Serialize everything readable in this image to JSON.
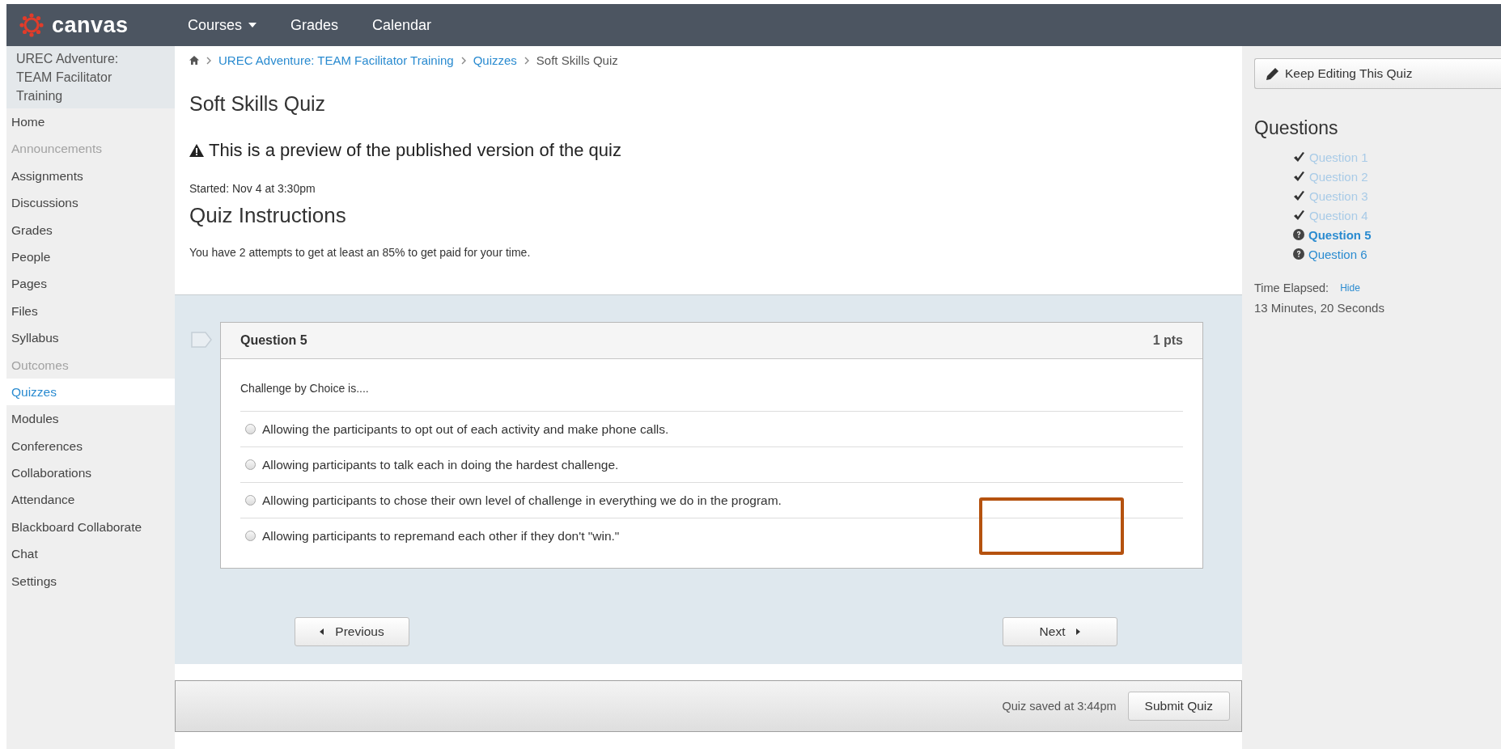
{
  "header": {
    "logo": "canvas",
    "nav": [
      {
        "label": "Courses",
        "dropdown": true
      },
      {
        "label": "Grades",
        "dropdown": false
      },
      {
        "label": "Calendar",
        "dropdown": false
      }
    ]
  },
  "sidebar": {
    "course_title": "UREC Adventure: TEAM Facilitator Training",
    "items": [
      {
        "label": "Home",
        "selected": false,
        "disabled": false
      },
      {
        "label": "Announcements",
        "selected": false,
        "disabled": true
      },
      {
        "label": "Assignments",
        "selected": false,
        "disabled": false
      },
      {
        "label": "Discussions",
        "selected": false,
        "disabled": false
      },
      {
        "label": "Grades",
        "selected": false,
        "disabled": false
      },
      {
        "label": "People",
        "selected": false,
        "disabled": false
      },
      {
        "label": "Pages",
        "selected": false,
        "disabled": false
      },
      {
        "label": "Files",
        "selected": false,
        "disabled": false
      },
      {
        "label": "Syllabus",
        "selected": false,
        "disabled": false
      },
      {
        "label": "Outcomes",
        "selected": false,
        "disabled": true
      },
      {
        "label": "Quizzes",
        "selected": true,
        "disabled": false
      },
      {
        "label": "Modules",
        "selected": false,
        "disabled": false
      },
      {
        "label": "Conferences",
        "selected": false,
        "disabled": false
      },
      {
        "label": "Collaborations",
        "selected": false,
        "disabled": false
      },
      {
        "label": "Attendance",
        "selected": false,
        "disabled": false
      },
      {
        "label": "Blackboard Collaborate",
        "selected": false,
        "disabled": false
      },
      {
        "label": "Chat",
        "selected": false,
        "disabled": false
      },
      {
        "label": "Settings",
        "selected": false,
        "disabled": false
      }
    ]
  },
  "breadcrumb": [
    {
      "label": "UREC Adventure: TEAM Facilitator Training",
      "link": true
    },
    {
      "label": "Quizzes",
      "link": true
    },
    {
      "label": "Soft Skills Quiz",
      "link": false
    }
  ],
  "quiz": {
    "title": "Soft Skills Quiz",
    "preview_notice": "This is a preview of the published version of the quiz",
    "started": "Started: Nov 4 at 3:30pm",
    "instructions_heading": "Quiz Instructions",
    "instructions": "You have 2 attempts to get at least an 85% to get paid for your time."
  },
  "question": {
    "title": "Question 5",
    "points": "1 pts",
    "prompt": "Challenge by Choice is....",
    "answers": [
      {
        "text": "Allowing the participants to opt out of each activity and make phone calls.",
        "selected": false
      },
      {
        "text": "Allowing participants to talk each in doing the hardest challenge.",
        "selected": false
      },
      {
        "text": "Allowing participants to chose their own level of challenge in everything we do in the program.",
        "selected": false
      },
      {
        "text": "Allowing participants to repremand each other if they don't \"win.\"",
        "selected": false
      }
    ]
  },
  "annotation": {
    "kind": "frame"
  },
  "navigation": {
    "previous": "Previous",
    "next": "Next"
  },
  "footer": {
    "saved": "Quiz saved at 3:44pm",
    "submit": "Submit Quiz"
  },
  "right_panel": {
    "edit_button": "Keep Editing This Quiz",
    "questions_heading": "Questions",
    "questions": [
      {
        "label": "Question 1",
        "answered": true,
        "selected": false
      },
      {
        "label": "Question 2",
        "answered": true,
        "selected": false
      },
      {
        "label": "Question 3",
        "answered": true,
        "selected": false
      },
      {
        "label": "Question 4",
        "answered": true,
        "selected": false
      },
      {
        "label": "Question 5",
        "answered": false,
        "selected": true
      },
      {
        "label": "Question 6",
        "answered": false,
        "selected": false
      }
    ],
    "time_label": "Time Elapsed:",
    "hide_link": "Hide",
    "time": "13 Minutes, 20 Seconds"
  }
}
